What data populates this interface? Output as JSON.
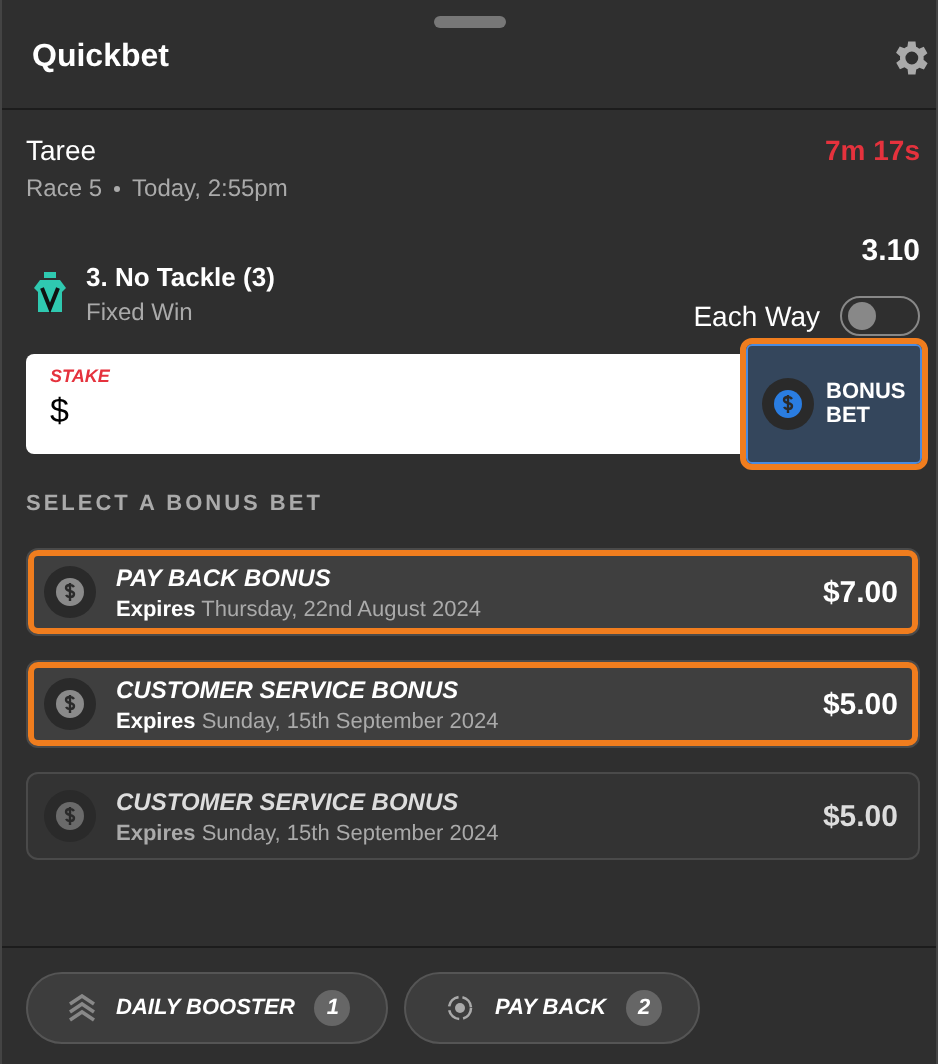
{
  "header": {
    "title": "Quickbet"
  },
  "race": {
    "venue": "Taree",
    "countdown": "7m 17s",
    "race_number": "Race 5",
    "time": "Today, 2:55pm"
  },
  "selection": {
    "runner": "3. No Tackle (3)",
    "bet_type": "Fixed Win",
    "odds": "3.10",
    "each_way": {
      "label": "Each Way",
      "on": false
    }
  },
  "stake": {
    "label": "STAKE",
    "currency": "$"
  },
  "bonus_button": {
    "label": "BONUS BET",
    "highlighted": true
  },
  "bonus_section": {
    "heading": "SELECT A BONUS BET"
  },
  "bonus_bets": [
    {
      "name": "PAY BACK BONUS",
      "expires_label": "Expires",
      "expires": "Thursday, 22nd August 2024",
      "amount": "$7.00",
      "highlighted": true,
      "disabled": false
    },
    {
      "name": "CUSTOMER SERVICE BONUS",
      "expires_label": "Expires",
      "expires": "Sunday, 15th September 2024",
      "amount": "$5.00",
      "highlighted": true,
      "disabled": false
    },
    {
      "name": "CUSTOMER SERVICE BONUS",
      "expires_label": "Expires",
      "expires": "Sunday, 15th September 2024",
      "amount": "$5.00",
      "highlighted": false,
      "disabled": true
    }
  ],
  "footer_pills": [
    {
      "kind": "booster",
      "label": "DAILY BOOSTER",
      "count": "1"
    },
    {
      "kind": "payback",
      "label": "PAY BACK",
      "count": "2"
    }
  ]
}
